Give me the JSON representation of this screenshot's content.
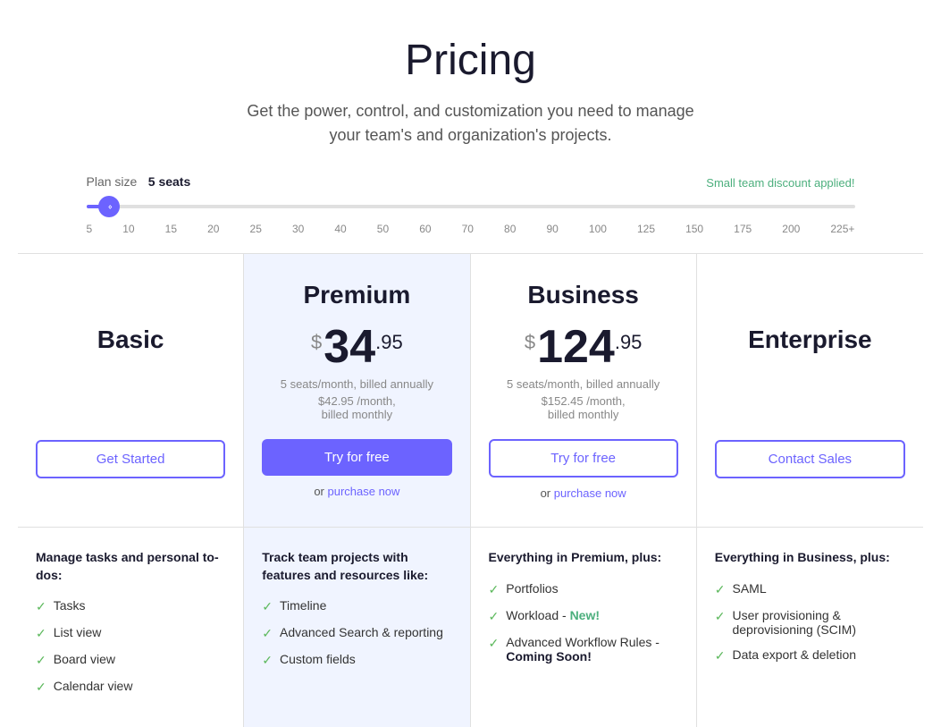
{
  "header": {
    "title": "Pricing",
    "subtitle": "Get the power, control, and customization you need to manage\nyour team's and organization's projects."
  },
  "slider": {
    "plan_size_label": "Plan size",
    "plan_size_value": "5 seats",
    "discount_label": "Small team discount applied!",
    "ticks": [
      "5",
      "10",
      "15",
      "20",
      "25",
      "30",
      "40",
      "50",
      "60",
      "70",
      "80",
      "90",
      "100",
      "125",
      "150",
      "175",
      "200",
      "225+"
    ]
  },
  "plans": [
    {
      "id": "basic",
      "name": "Basic",
      "price": null,
      "period": null,
      "monthly_alt": null,
      "cta_label": "Get Started",
      "cta_type": "outline",
      "purchase_link": null,
      "highlighted": false,
      "features_title": "Manage tasks and personal to-dos:",
      "features": [
        {
          "text": "Tasks"
        },
        {
          "text": "List view"
        },
        {
          "text": "Board view"
        },
        {
          "text": "Calendar view"
        }
      ]
    },
    {
      "id": "premium",
      "name": "Premium",
      "currency": "$",
      "price_main": "34",
      "price_cents": ".95",
      "period": "5 seats/month, billed annually",
      "monthly_alt": "$42.95 /month,\nbilled monthly",
      "cta_label": "Try for free",
      "cta_type": "primary",
      "purchase_text": "or ",
      "purchase_link": "purchase now",
      "highlighted": true,
      "features_title": "Track team projects with features and resources like:",
      "features": [
        {
          "text": "Timeline"
        },
        {
          "text": "Advanced Search & reporting"
        },
        {
          "text": "Custom fields"
        }
      ]
    },
    {
      "id": "business",
      "name": "Business",
      "currency": "$",
      "price_main": "124",
      "price_cents": ".95",
      "period": "5 seats/month, billed annually",
      "monthly_alt": "$152.45 /month,\nbilled monthly",
      "cta_label": "Try for free",
      "cta_type": "outline",
      "purchase_text": "or ",
      "purchase_link": "purchase now",
      "highlighted": false,
      "features_title": "Everything in Premium, plus:",
      "features": [
        {
          "text": "Portfolios"
        },
        {
          "text": "Workload - ",
          "badge": "New!",
          "badge_type": "new"
        },
        {
          "text": "Advanced Workflow Rules - ",
          "badge": "Coming Soon!",
          "badge_type": "coming-soon"
        }
      ]
    },
    {
      "id": "enterprise",
      "name": "Enterprise",
      "price": null,
      "period": null,
      "monthly_alt": null,
      "cta_label": "Contact Sales",
      "cta_type": "outline",
      "purchase_link": null,
      "highlighted": false,
      "features_title": "Everything in Business, plus:",
      "features": [
        {
          "text": "SAML"
        },
        {
          "text": "User provisioning & deprovisioning (SCIM)"
        },
        {
          "text": "Data export & deletion"
        }
      ]
    }
  ]
}
